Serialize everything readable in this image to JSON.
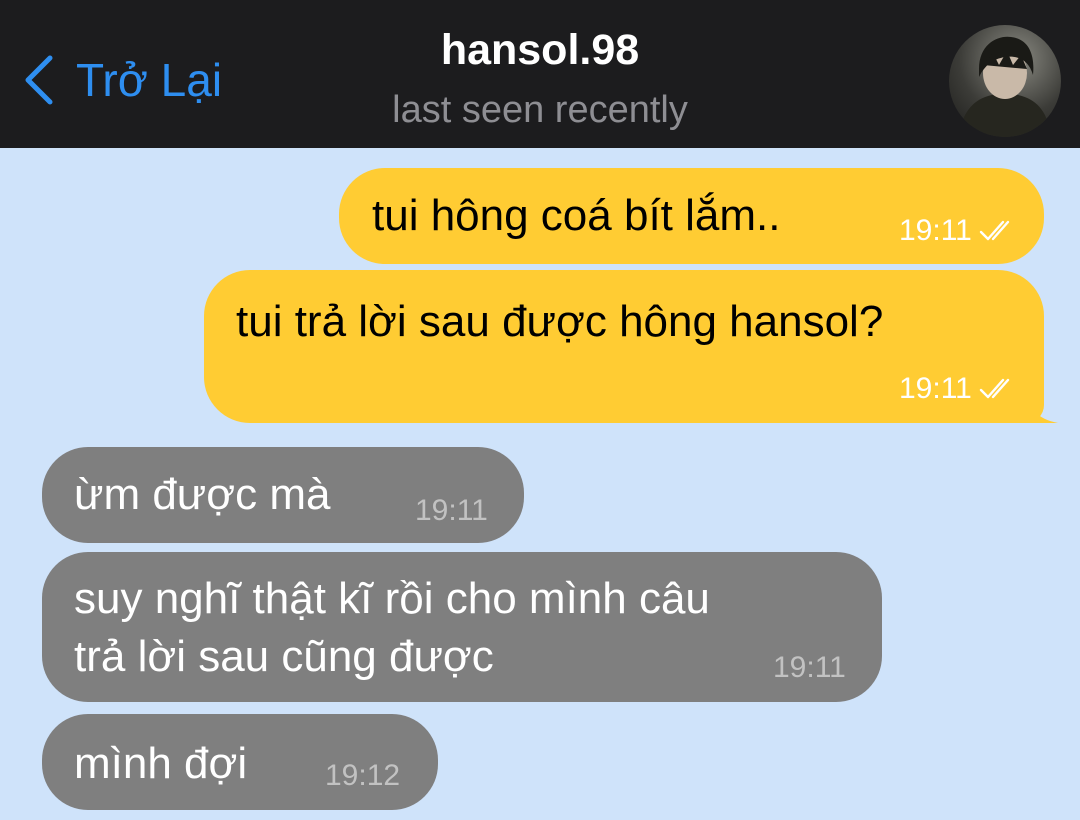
{
  "header": {
    "back_label": "Trở Lại",
    "contact_name": "hansol.98",
    "status": "last seen recently"
  },
  "colors": {
    "outgoing_bubble": "#ffcc33",
    "incoming_bubble": "#7f7f7f",
    "chat_background": "#cfe3fa",
    "accent": "#2e8ef0"
  },
  "messages": [
    {
      "direction": "outgoing",
      "text": "tui hông coá bít lắm..",
      "time": "19:11",
      "read": true
    },
    {
      "direction": "outgoing",
      "text": "tui trả lời sau được hông hansol?",
      "time": "19:11",
      "read": true
    },
    {
      "direction": "incoming",
      "text": "ừm được mà",
      "time": "19:11"
    },
    {
      "direction": "incoming",
      "text": "suy nghĩ thật kĩ rồi cho mình câu\ntrả lời sau cũng được",
      "time": "19:11"
    },
    {
      "direction": "incoming",
      "text": "mình đợi",
      "time": "19:12"
    }
  ]
}
